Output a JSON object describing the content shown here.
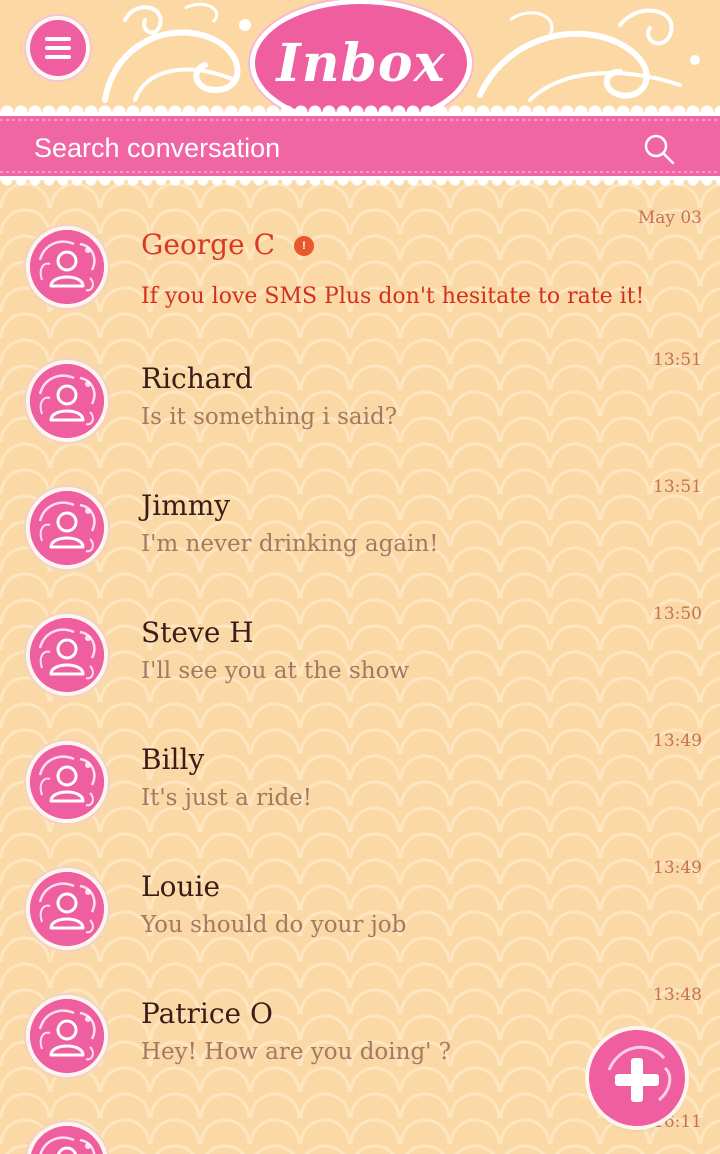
{
  "header": {
    "title": "Inbox",
    "menu_icon": "hamburger-menu-icon"
  },
  "search": {
    "placeholder": "Search conversation",
    "icon": "search-icon"
  },
  "conversations": [
    {
      "name": "George C",
      "snippet": "If you love SMS Plus don't hesitate to rate it!",
      "time": "May 03",
      "unread": true
    },
    {
      "name": "Richard",
      "snippet": "Is it something i said?",
      "time": "13:51",
      "unread": false
    },
    {
      "name": "Jimmy",
      "snippet": "I'm never drinking again!",
      "time": "13:51",
      "unread": false
    },
    {
      "name": "Steve H",
      "snippet": "I'll see you at the show",
      "time": "13:50",
      "unread": false
    },
    {
      "name": "Billy",
      "snippet": "It's just a ride!",
      "time": "13:49",
      "unread": false
    },
    {
      "name": "Louie",
      "snippet": "You should do your job",
      "time": "13:49",
      "unread": false
    },
    {
      "name": "Patrice O",
      "snippet": "Hey! How are you doing' ?",
      "time": "13:48",
      "unread": false
    },
    {
      "name": "",
      "snippet": "",
      "time": "16:11",
      "unread": false
    }
  ],
  "fab": {
    "icon": "compose-plus-icon"
  },
  "colors": {
    "accent_pink": "#ef5f9f",
    "background": "#fbd9a7",
    "unread_red": "#d63a24",
    "name_dark": "#3a1d17",
    "snippet_brown": "#a07a62"
  }
}
